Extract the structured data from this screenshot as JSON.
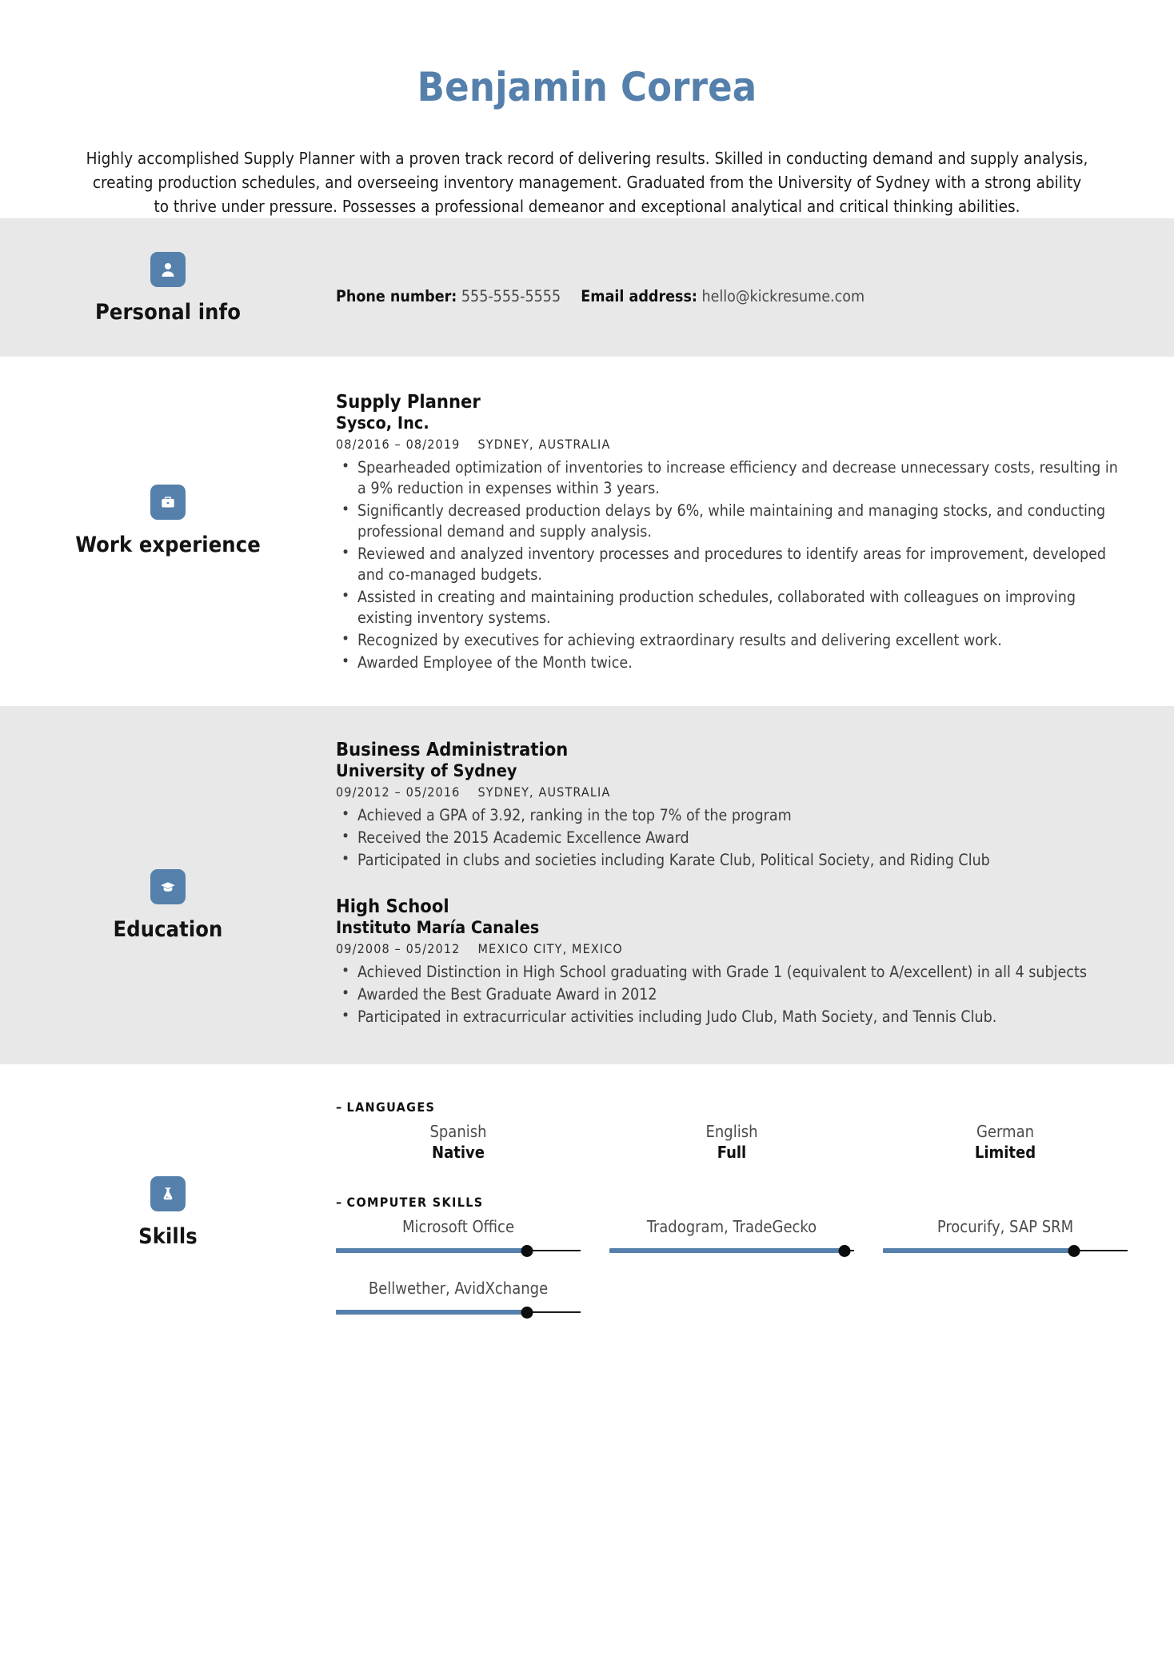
{
  "header": {
    "name": "Benjamin Correa",
    "name_color": "#5580ab",
    "summary": "Highly accomplished Supply Planner with a proven track record of delivering results. Skilled in conducting demand and supply analysis, creating production schedules, and overseeing inventory management. Graduated from the University of Sydney with a strong ability to thrive under pressure. Possesses a professional demeanor and exceptional analytical and critical thinking abilities."
  },
  "sections": {
    "personal_info": {
      "title": "Personal info",
      "icon": "person-icon",
      "phone_label": "Phone number:",
      "phone_value": "555-555-5555",
      "email_label": "Email address:",
      "email_value": "hello@kickresume.com"
    },
    "work_experience": {
      "title": "Work experience",
      "icon": "briefcase-icon",
      "entries": [
        {
          "position": "Supply Planner",
          "company": "Sysco, Inc.",
          "dates": "08/2016 – 08/2019",
          "location": "SYDNEY, AUSTRALIA",
          "bullets": [
            "Spearheaded optimization of inventories to increase efficiency and decrease unnecessary costs, resulting in a 9% reduction in expenses within 3 years.",
            "Significantly decreased production delays by 6%, while maintaining and managing stocks, and conducting professional demand and supply analysis.",
            "Reviewed and analyzed inventory processes and procedures to identify areas for improvement, developed and co-managed budgets.",
            "Assisted in creating and maintaining production schedules, collaborated with colleagues on improving existing inventory systems.",
            "Recognized by executives for achieving extraordinary results and delivering excellent work.",
            "Awarded Employee of the Month twice."
          ]
        }
      ]
    },
    "education": {
      "title": "Education",
      "icon": "graduation-cap-icon",
      "entries": [
        {
          "position": "Business Administration",
          "company": "University of Sydney",
          "dates": "09/2012 – 05/2016",
          "location": "SYDNEY, AUSTRALIA",
          "bullets": [
            "Achieved a GPA of 3.92, ranking in the top 7% of the program",
            "Received the 2015 Academic Excellence Award",
            "Participated in clubs and societies including Karate Club, Political Society, and Riding Club"
          ]
        },
        {
          "position": "High School",
          "company": "Instituto María Canales",
          "dates": "09/2008 – 05/2012",
          "location": "MEXICO CITY, MEXICO",
          "bullets": [
            "Achieved Distinction in High School graduating with Grade 1 (equivalent to A/excellent) in all 4 subjects",
            "Awarded the Best Graduate Award in 2012",
            "Participated in extracurricular activities including Judo Club, Math Society, and Tennis Club."
          ]
        }
      ]
    },
    "skills": {
      "title": "Skills",
      "icon": "flask-icon",
      "languages": {
        "heading": "LANGUAGES",
        "dash": "–",
        "items": [
          {
            "name": "Spanish",
            "level": "Native"
          },
          {
            "name": "English",
            "level": "Full"
          },
          {
            "name": "German",
            "level": "Limited"
          }
        ]
      },
      "computer_skills": {
        "heading": "COMPUTER SKILLS",
        "dash": "–",
        "items": [
          {
            "name": "Microsoft Office",
            "level_pct": 78
          },
          {
            "name": "Tradogram, TradeGecko",
            "level_pct": 96
          },
          {
            "name": "Procurify, SAP SRM",
            "level_pct": 78
          },
          {
            "name": "Bellwether, AvidXchange",
            "level_pct": 78
          }
        ]
      }
    }
  },
  "theme": {
    "accent": "#5580ab",
    "shaded_band": "#e8e8e8",
    "text": "#1b1b1b"
  }
}
